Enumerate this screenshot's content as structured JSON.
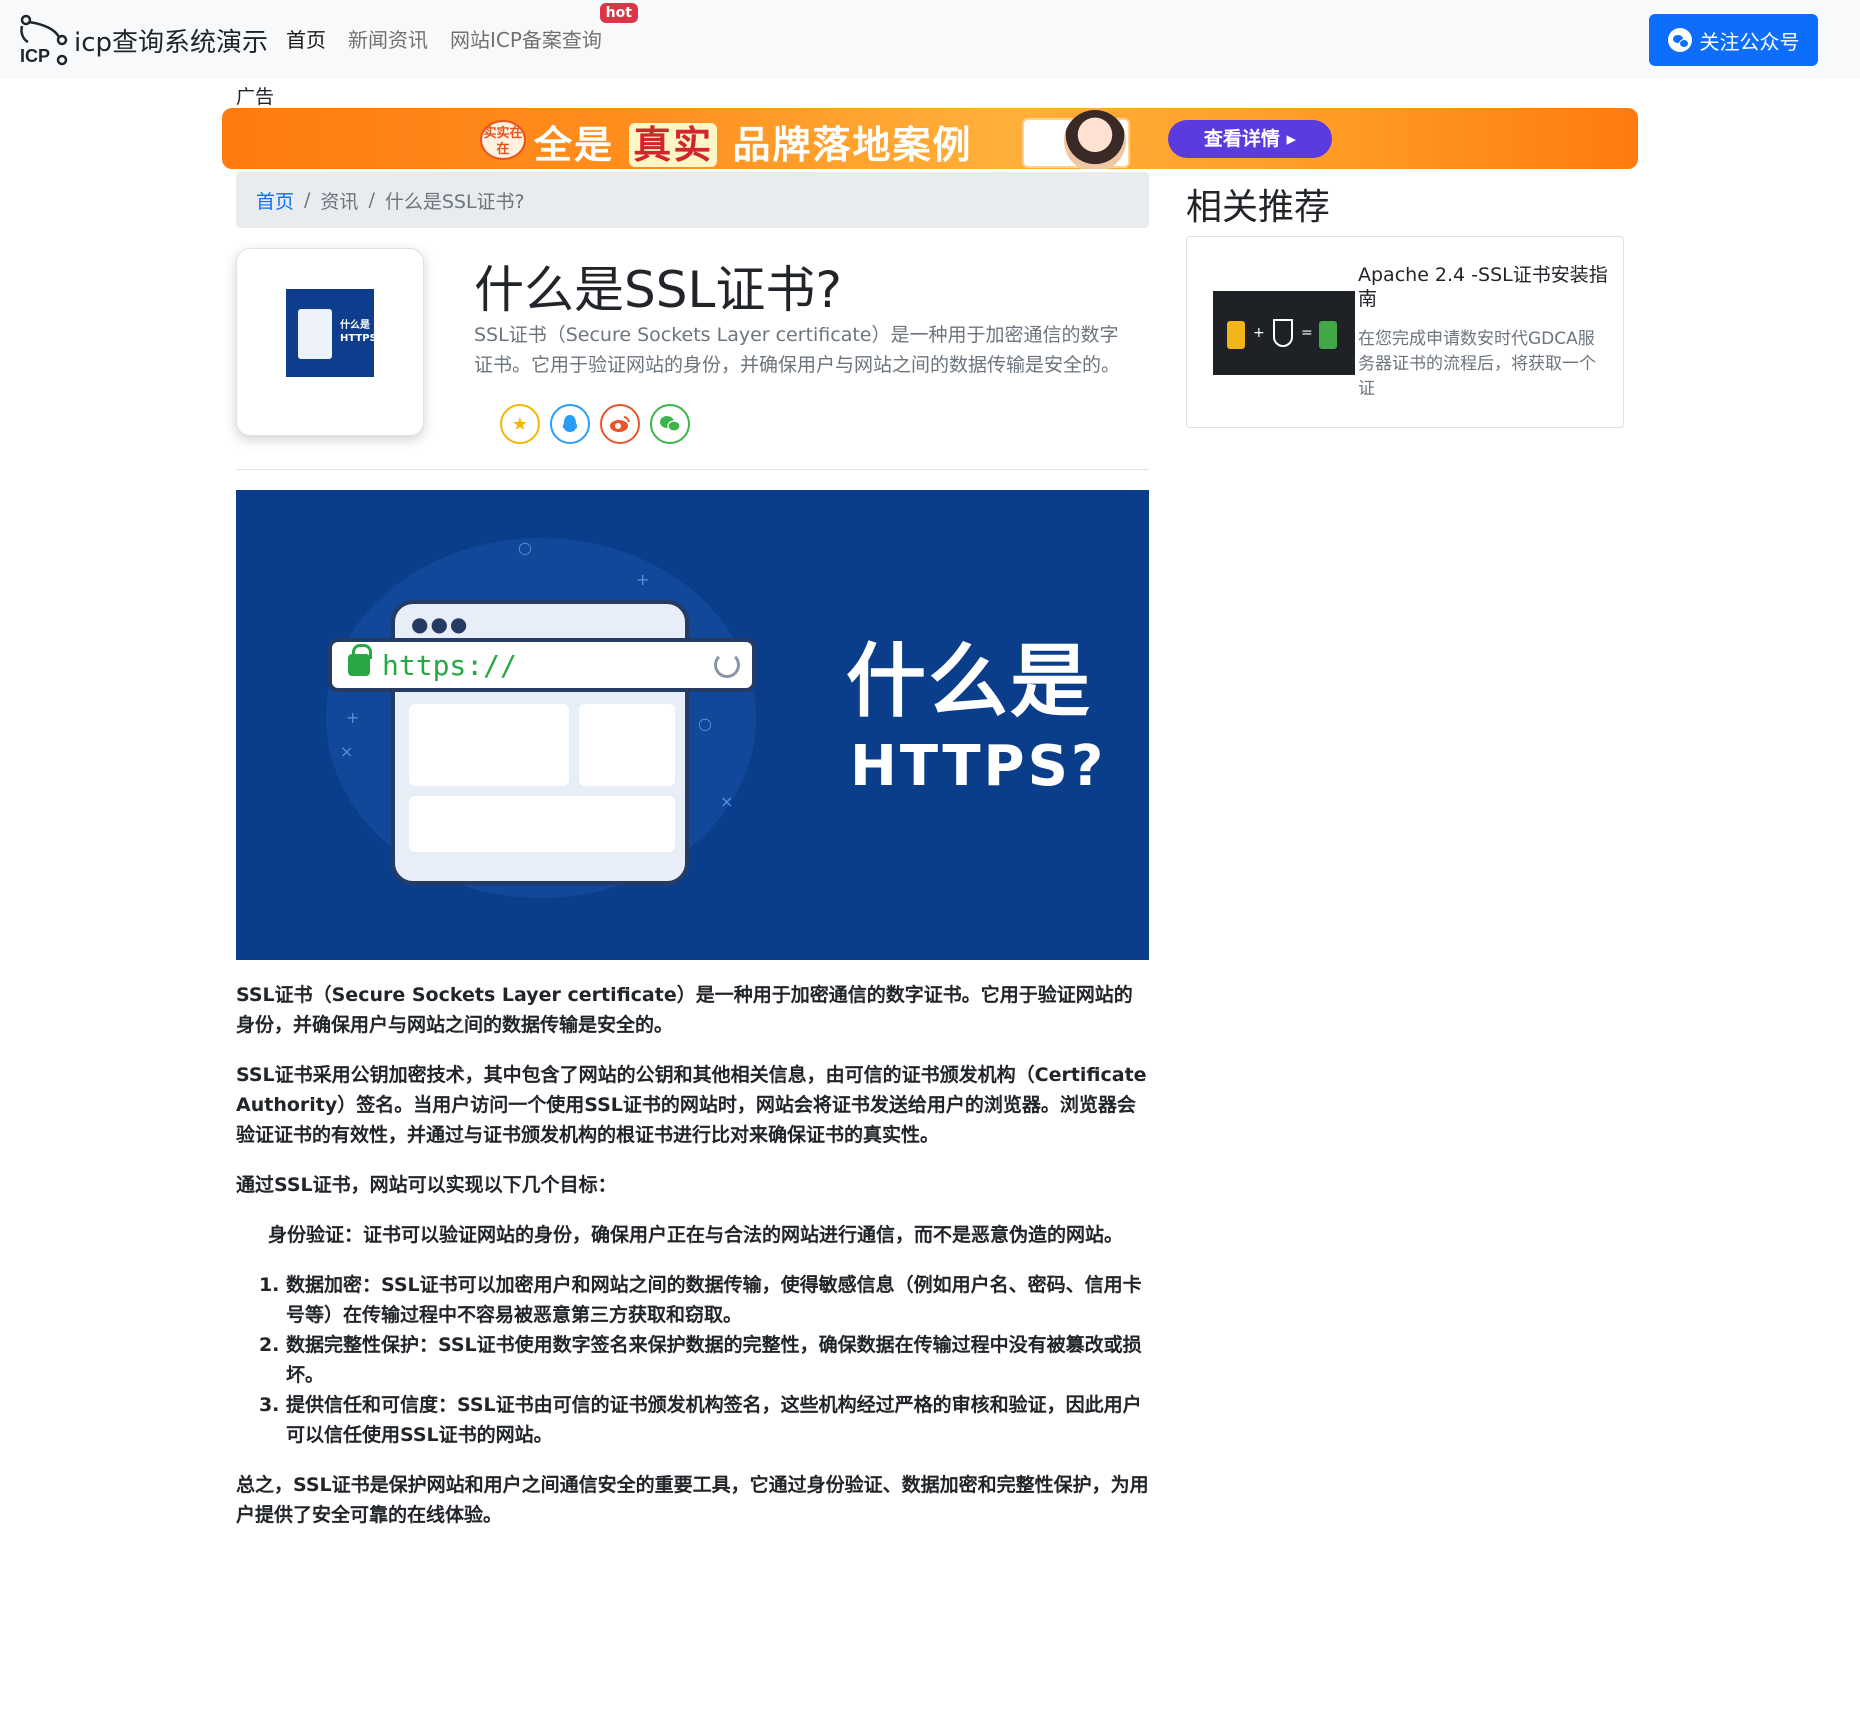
{
  "navbar": {
    "brand": "icp查询系统演示",
    "links": [
      {
        "label": "首页"
      },
      {
        "label": "新闻资讯"
      },
      {
        "label": "网站ICP备案查询"
      }
    ],
    "hot_badge": "hot",
    "follow_button": "关注公众号",
    "accent_color": "#0d6efd"
  },
  "ad": {
    "label": "广告",
    "seal_text": "实实在在",
    "headline_pre": "全是",
    "headline_highlight": "真实",
    "headline_post": "品牌落地案例",
    "cta": "查看详情 ▸"
  },
  "breadcrumb": {
    "home": "首页",
    "section": "资讯",
    "current": "什么是SSL证书?",
    "separator": "/"
  },
  "article": {
    "thumb_text": "什么是 HTTPS?",
    "title": "什么是SSL证书?",
    "lead": "SSL证书（Secure Sockets Layer certificate）是一种用于加密通信的数字证书。它用于验证网站的身份，并确保用户与网站之间的数据传输是安全的。",
    "share_icons": [
      "star-icon",
      "qq-icon",
      "weibo-icon",
      "wechat-icon"
    ],
    "hero": {
      "url": "https://",
      "title": "什么是",
      "subtitle": "HTTPS?"
    },
    "paragraphs": [
      "SSL证书（Secure Sockets Layer certificate）是一种用于加密通信的数字证书。它用于验证网站的身份，并确保用户与网站之间的数据传输是安全的。",
      "SSL证书采用公钥加密技术，其中包含了网站的公钥和其他相关信息，由可信的证书颁发机构（Certificate Authority）签名。当用户访问一个使用SSL证书的网站时，网站会将证书发送给用户的浏览器。浏览器会验证证书的有效性，并通过与证书颁发机构的根证书进行比对来确保证书的真实性。",
      "通过SSL证书，网站可以实现以下几个目标："
    ],
    "indented": "身份验证：证书可以验证网站的身份，确保用户正在与合法的网站进行通信，而不是恶意伪造的网站。",
    "list": [
      "数据加密：SSL证书可以加密用户和网站之间的数据传输，使得敏感信息（例如用户名、密码、信用卡号等）在传输过程中不容易被恶意第三方获取和窃取。",
      "数据完整性保护：SSL证书使用数字签名来保护数据的完整性，确保数据在传输过程中没有被篡改或损坏。",
      "提供信任和可信度：SSL证书由可信的证书颁发机构签名，这些机构经过严格的审核和验证，因此用户可以信任使用SSL证书的网站。"
    ],
    "conclusion": "总之，SSL证书是保护网站和用户之间通信安全的重要工具，它通过身份验证、数据加密和完整性保护，为用户提供了安全可靠的在线体验。"
  },
  "sidebar": {
    "title": "相关推荐",
    "card": {
      "title": "Apache 2.4 -SSL证书安装指南",
      "description": "在您完成申请数安时代GDCA服务器证书的流程后，将获取一个证"
    }
  }
}
